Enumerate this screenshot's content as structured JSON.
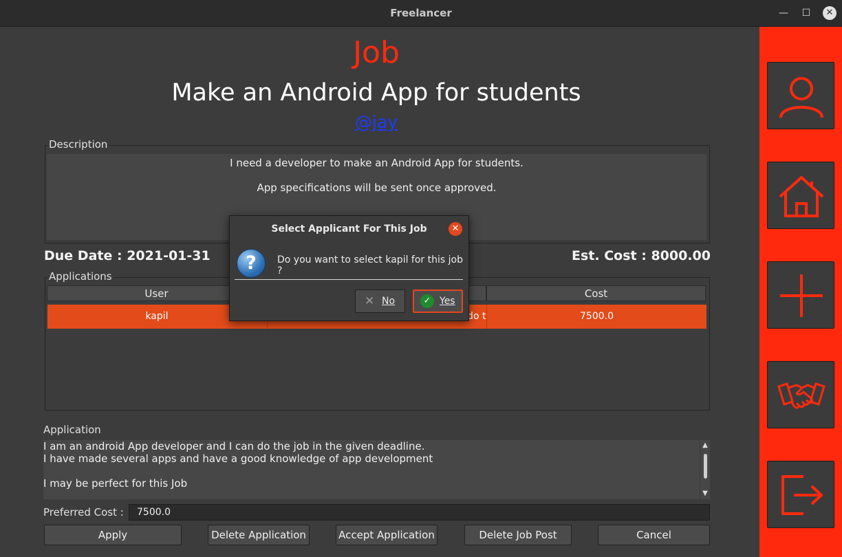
{
  "window": {
    "title": "Freelancer",
    "minimize_glyph": "—",
    "maximize_glyph": "☐",
    "close_glyph": "✕"
  },
  "job": {
    "heading": "Job",
    "title": "Make an Android App for students",
    "owner": "@jay",
    "description_label": "Description",
    "description_lines": [
      "I need a developer to make an Android App for students.",
      "App specifications will be sent once approved."
    ],
    "due_date": "Due Date : 2021-01-31",
    "est_cost": "Est. Cost : 8000.00"
  },
  "applications": {
    "label": "Applications",
    "columns": [
      "User",
      "",
      "Cost"
    ],
    "rows": [
      {
        "user": "kapil",
        "application": "I am an android App developer and I can do t...",
        "cost": "7500.0"
      }
    ]
  },
  "application": {
    "label": "Application",
    "lines": [
      "I am an android App developer and I can do the job in the given deadline.",
      "I have made several apps and have a good knowledge of app development",
      "",
      "I may be perfect for this Job"
    ],
    "preferred_cost_label": "Preferred Cost :",
    "preferred_cost_value": "7500.0"
  },
  "buttons": {
    "apply": "Apply",
    "delete_application": "Delete Application",
    "accept_application": "Accept Application",
    "delete_job_post": "Delete Job Post",
    "cancel": "Cancel"
  },
  "sidebar": {
    "items": [
      {
        "name": "profile",
        "icon": "user-icon"
      },
      {
        "name": "home",
        "icon": "home-icon"
      },
      {
        "name": "add",
        "icon": "plus-icon"
      },
      {
        "name": "deals",
        "icon": "handshake-icon"
      },
      {
        "name": "logout",
        "icon": "logout-icon"
      }
    ],
    "accent_color": "#ff2a0d"
  },
  "dialog": {
    "title": "Select Applicant For This Job",
    "message": "Do you want to select kapil for this job ?",
    "no_label": "No",
    "yes_label": "Yes",
    "icon": "question-icon"
  },
  "colors": {
    "accent": "#ff2a0d",
    "selection": "#e34b1a",
    "link": "#1a3cff",
    "background": "#3c3c3c"
  }
}
